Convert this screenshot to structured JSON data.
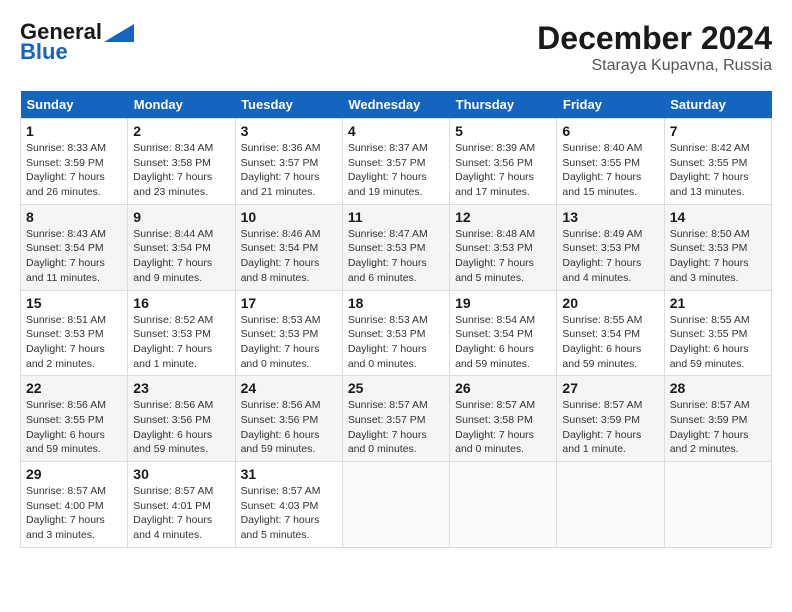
{
  "header": {
    "logo_line1": "General",
    "logo_line2": "Blue",
    "month": "December 2024",
    "location": "Staraya Kupavna, Russia"
  },
  "days_of_week": [
    "Sunday",
    "Monday",
    "Tuesday",
    "Wednesday",
    "Thursday",
    "Friday",
    "Saturday"
  ],
  "weeks": [
    [
      {
        "num": "1",
        "info": "Sunrise: 8:33 AM\nSunset: 3:59 PM\nDaylight: 7 hours\nand 26 minutes."
      },
      {
        "num": "2",
        "info": "Sunrise: 8:34 AM\nSunset: 3:58 PM\nDaylight: 7 hours\nand 23 minutes."
      },
      {
        "num": "3",
        "info": "Sunrise: 8:36 AM\nSunset: 3:57 PM\nDaylight: 7 hours\nand 21 minutes."
      },
      {
        "num": "4",
        "info": "Sunrise: 8:37 AM\nSunset: 3:57 PM\nDaylight: 7 hours\nand 19 minutes."
      },
      {
        "num": "5",
        "info": "Sunrise: 8:39 AM\nSunset: 3:56 PM\nDaylight: 7 hours\nand 17 minutes."
      },
      {
        "num": "6",
        "info": "Sunrise: 8:40 AM\nSunset: 3:55 PM\nDaylight: 7 hours\nand 15 minutes."
      },
      {
        "num": "7",
        "info": "Sunrise: 8:42 AM\nSunset: 3:55 PM\nDaylight: 7 hours\nand 13 minutes."
      }
    ],
    [
      {
        "num": "8",
        "info": "Sunrise: 8:43 AM\nSunset: 3:54 PM\nDaylight: 7 hours\nand 11 minutes."
      },
      {
        "num": "9",
        "info": "Sunrise: 8:44 AM\nSunset: 3:54 PM\nDaylight: 7 hours\nand 9 minutes."
      },
      {
        "num": "10",
        "info": "Sunrise: 8:46 AM\nSunset: 3:54 PM\nDaylight: 7 hours\nand 8 minutes."
      },
      {
        "num": "11",
        "info": "Sunrise: 8:47 AM\nSunset: 3:53 PM\nDaylight: 7 hours\nand 6 minutes."
      },
      {
        "num": "12",
        "info": "Sunrise: 8:48 AM\nSunset: 3:53 PM\nDaylight: 7 hours\nand 5 minutes."
      },
      {
        "num": "13",
        "info": "Sunrise: 8:49 AM\nSunset: 3:53 PM\nDaylight: 7 hours\nand 4 minutes."
      },
      {
        "num": "14",
        "info": "Sunrise: 8:50 AM\nSunset: 3:53 PM\nDaylight: 7 hours\nand 3 minutes."
      }
    ],
    [
      {
        "num": "15",
        "info": "Sunrise: 8:51 AM\nSunset: 3:53 PM\nDaylight: 7 hours\nand 2 minutes."
      },
      {
        "num": "16",
        "info": "Sunrise: 8:52 AM\nSunset: 3:53 PM\nDaylight: 7 hours\nand 1 minute."
      },
      {
        "num": "17",
        "info": "Sunrise: 8:53 AM\nSunset: 3:53 PM\nDaylight: 7 hours\nand 0 minutes."
      },
      {
        "num": "18",
        "info": "Sunrise: 8:53 AM\nSunset: 3:53 PM\nDaylight: 7 hours\nand 0 minutes."
      },
      {
        "num": "19",
        "info": "Sunrise: 8:54 AM\nSunset: 3:54 PM\nDaylight: 6 hours\nand 59 minutes."
      },
      {
        "num": "20",
        "info": "Sunrise: 8:55 AM\nSunset: 3:54 PM\nDaylight: 6 hours\nand 59 minutes."
      },
      {
        "num": "21",
        "info": "Sunrise: 8:55 AM\nSunset: 3:55 PM\nDaylight: 6 hours\nand 59 minutes."
      }
    ],
    [
      {
        "num": "22",
        "info": "Sunrise: 8:56 AM\nSunset: 3:55 PM\nDaylight: 6 hours\nand 59 minutes."
      },
      {
        "num": "23",
        "info": "Sunrise: 8:56 AM\nSunset: 3:56 PM\nDaylight: 6 hours\nand 59 minutes."
      },
      {
        "num": "24",
        "info": "Sunrise: 8:56 AM\nSunset: 3:56 PM\nDaylight: 6 hours\nand 59 minutes."
      },
      {
        "num": "25",
        "info": "Sunrise: 8:57 AM\nSunset: 3:57 PM\nDaylight: 7 hours\nand 0 minutes."
      },
      {
        "num": "26",
        "info": "Sunrise: 8:57 AM\nSunset: 3:58 PM\nDaylight: 7 hours\nand 0 minutes."
      },
      {
        "num": "27",
        "info": "Sunrise: 8:57 AM\nSunset: 3:59 PM\nDaylight: 7 hours\nand 1 minute."
      },
      {
        "num": "28",
        "info": "Sunrise: 8:57 AM\nSunset: 3:59 PM\nDaylight: 7 hours\nand 2 minutes."
      }
    ],
    [
      {
        "num": "29",
        "info": "Sunrise: 8:57 AM\nSunset: 4:00 PM\nDaylight: 7 hours\nand 3 minutes."
      },
      {
        "num": "30",
        "info": "Sunrise: 8:57 AM\nSunset: 4:01 PM\nDaylight: 7 hours\nand 4 minutes."
      },
      {
        "num": "31",
        "info": "Sunrise: 8:57 AM\nSunset: 4:03 PM\nDaylight: 7 hours\nand 5 minutes."
      },
      null,
      null,
      null,
      null
    ]
  ]
}
